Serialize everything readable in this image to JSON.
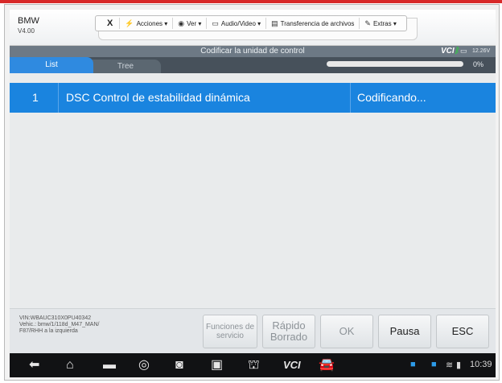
{
  "header": {
    "app_name": "BMW",
    "version": "V4.00"
  },
  "toolbar": {
    "close": "X",
    "actions": "Acciones ▾",
    "view": "Ver ▾",
    "audio_video": "Audio/Video ▾",
    "file_transfer": "Transferencia de archivos",
    "extras": "Extras ▾"
  },
  "status": {
    "title": "Codificar la unidad de control",
    "vci": "VCI",
    "voltage": "12.26V"
  },
  "tabs": {
    "list": "List",
    "tree": "Tree"
  },
  "progress": {
    "value_percent": 0,
    "label": "0%"
  },
  "table": {
    "rows": [
      {
        "number": "1",
        "name": "DSC Control de estabilidad dinámica",
        "status": "Codificando..."
      }
    ]
  },
  "vehicle_info": {
    "line1": "VIN:WBAUC310X0PU40342",
    "line2": "Vehic.: bmw/1/118d_M47_MAN/",
    "line3": "F87/RHH a la izquierda"
  },
  "buttons": {
    "service": "Funciones de servicio",
    "quick_erase": "Rápido Borrado",
    "ok": "OK",
    "pause": "Pausa",
    "esc": "ESC"
  },
  "navbar": {
    "time": "10:39"
  },
  "colors": {
    "accent": "#1a84df",
    "status_bar": "#6d7985",
    "tab_bar": "#47515b",
    "nav_bar": "#111214"
  }
}
